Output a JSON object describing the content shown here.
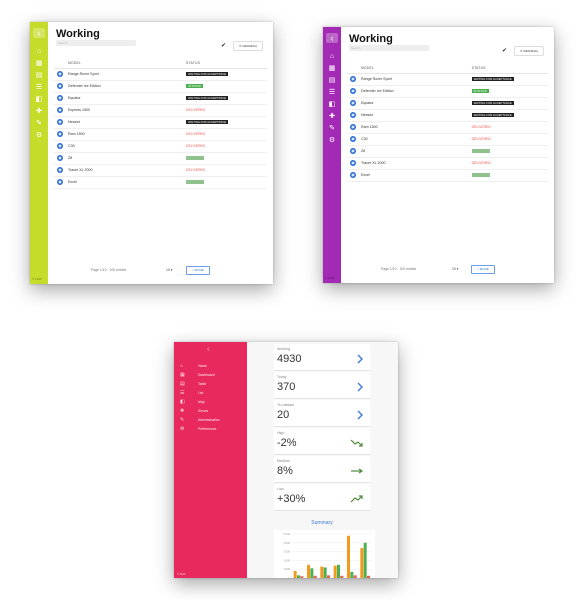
{
  "working_panels": [
    {
      "accent": "#c6dc2a",
      "title": "Working",
      "search_placeholder": "Search",
      "refresh_label": "REFRESH",
      "col_model": "MODEL",
      "col_status": "STATUS",
      "footer": "© 2016",
      "pager_info": "Page 1/10 · 100 entries",
      "pager_size": "10",
      "more_label": "+ MORE",
      "rows": [
        {
          "model": "Range Rover Sport",
          "status": "WAITING FOR ACCEPTANCE",
          "kind": "dark"
        },
        {
          "model": "Defender Ice Edition",
          "status": "IN STOCK",
          "kind": "green"
        },
        {
          "model": "Equator",
          "status": "WAITING FOR ACCEPTANCE",
          "kind": "dark"
        },
        {
          "model": "Express 1500",
          "status": "DELIVERED",
          "kind": "red"
        },
        {
          "model": "Nexsist",
          "status": "WAITING FOR ACCEPTANCE",
          "kind": "dark"
        },
        {
          "model": "Ram 1500",
          "status": "DELIVERED",
          "kind": "red"
        },
        {
          "model": "C30",
          "status": "DELIVERED",
          "kind": "red"
        },
        {
          "model": "Z8",
          "status": "",
          "kind": "muted"
        },
        {
          "model": "Tracer XL 2000",
          "status": "DELIVERED",
          "kind": "red"
        },
        {
          "model": "Excel",
          "status": "",
          "kind": "muted"
        }
      ]
    },
    {
      "accent": "#a22ab4",
      "title": "Working",
      "search_placeholder": "Search",
      "refresh_label": "REFRESH",
      "col_model": "MODEL",
      "col_status": "STATUS",
      "footer": "© 2016",
      "pager_info": "Page 1/10 · 100 entries",
      "pager_size": "10",
      "more_label": "+ MORE",
      "rows": [
        {
          "model": "Range Rover Sport",
          "status": "WAITING FOR ACCEPTANCE",
          "kind": "dark"
        },
        {
          "model": "Defender Ice Edition",
          "status": "IN STOCK",
          "kind": "green"
        },
        {
          "model": "Equator",
          "status": "WAITING FOR ACCEPTANCE",
          "kind": "dark"
        },
        {
          "model": "Nexsist",
          "status": "WAITING FOR ACCEPTANCE",
          "kind": "dark"
        },
        {
          "model": "Ram 1500",
          "status": "DELIVERED",
          "kind": "red"
        },
        {
          "model": "C30",
          "status": "DELIVERED",
          "kind": "red"
        },
        {
          "model": "Z8",
          "status": "",
          "kind": "muted"
        },
        {
          "model": "Tracer XL 2000",
          "status": "DELIVERED",
          "kind": "red"
        },
        {
          "model": "Excel",
          "status": "",
          "kind": "muted"
        }
      ]
    }
  ],
  "dashboard": {
    "accent": "#e8295e",
    "nav": [
      {
        "icon": "home-icon",
        "label": "Home"
      },
      {
        "icon": "dashboard-icon",
        "label": "Dashboard"
      },
      {
        "icon": "table-icon",
        "label": "Table"
      },
      {
        "icon": "list-icon",
        "label": "List"
      },
      {
        "icon": "map-icon",
        "label": "Map"
      },
      {
        "icon": "plus-icon",
        "label": "Shows"
      },
      {
        "icon": "wrench-icon",
        "label": "Administration"
      },
      {
        "icon": "settings-icon",
        "label": "Preferences"
      }
    ],
    "footer": "© 2016",
    "stats": [
      {
        "label": "Working",
        "value": "4930",
        "trend": "chevron"
      },
      {
        "label": "Today",
        "value": "370",
        "trend": "chevron"
      },
      {
        "label": "To validate",
        "value": "20",
        "trend": "chevron"
      },
      {
        "label": "High",
        "value": "-2%",
        "trend": "down"
      },
      {
        "label": "Medium",
        "value": "8%",
        "trend": "flat"
      },
      {
        "label": "Low",
        "value": "+30%",
        "trend": "up"
      }
    ],
    "summary_title": "Summary",
    "chart_data": {
      "type": "bar",
      "title": "",
      "xlabel": "",
      "ylabel": "",
      "ylim": [
        0,
        5000
      ],
      "yticks": [
        "5,000",
        "4,000",
        "3,000",
        "2,000",
        "1,000",
        "0"
      ],
      "categories": [
        "1",
        "2",
        "3",
        "4",
        "5",
        "6"
      ],
      "series": [
        {
          "name": "",
          "color": "#f39a1e",
          "values": [
            800,
            1500,
            1300,
            1400,
            4800,
            3400
          ]
        },
        {
          "name": "",
          "color": "#4caf50",
          "values": [
            300,
            1100,
            1200,
            1500,
            700,
            4000
          ]
        },
        {
          "name": "",
          "color": "#e85c4a",
          "values": [
            200,
            250,
            300,
            250,
            300,
            250
          ]
        }
      ]
    }
  }
}
